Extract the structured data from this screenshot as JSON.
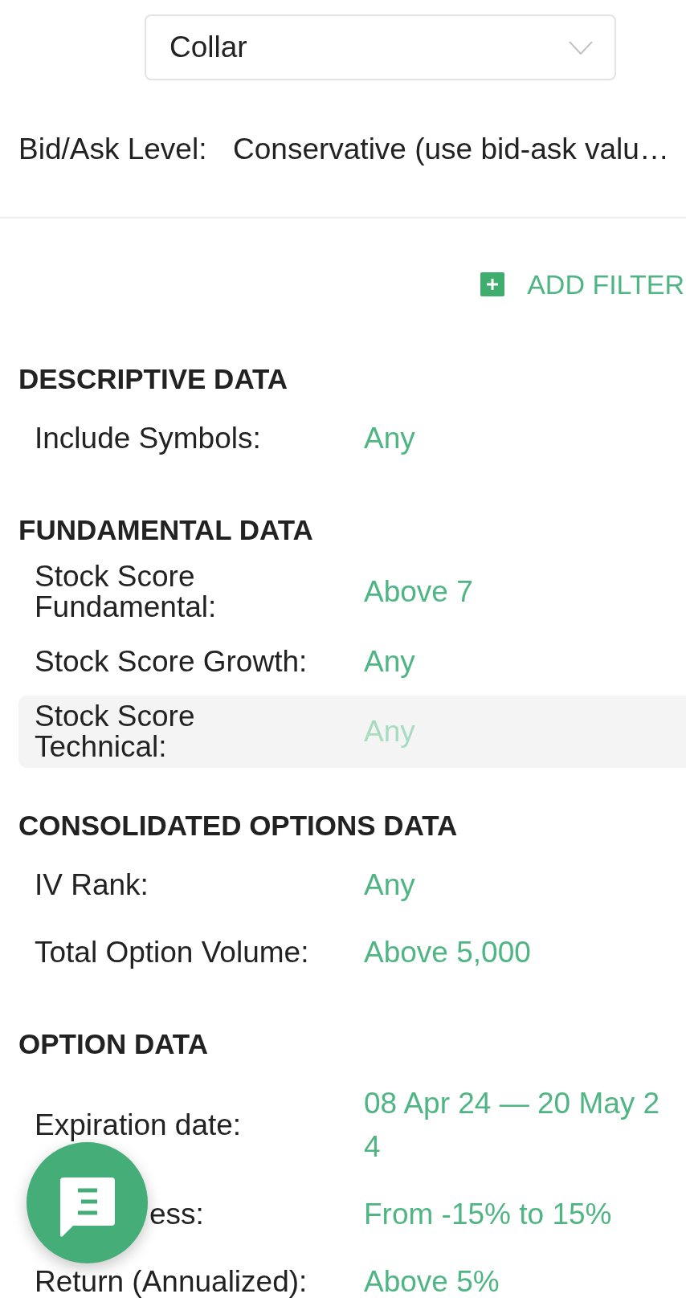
{
  "strategy_select": {
    "value": "Collar"
  },
  "bid_ask": {
    "label": "Bid/Ask Level:",
    "value": "Conservative (use bid-ask valu…"
  },
  "add_filter": {
    "label": "ADD FILTER"
  },
  "sections": [
    {
      "title": "DESCRIPTIVE DATA",
      "filters": [
        {
          "label": "Include Symbols:",
          "value": "Any",
          "highlighted": false,
          "partly_hidden": false
        }
      ]
    },
    {
      "title": "FUNDAMENTAL DATA",
      "filters": [
        {
          "label": "Stock Score Fundamental:",
          "value": "Above 7",
          "highlighted": false,
          "partly_hidden": false
        },
        {
          "label": "Stock Score Growth:",
          "value": "Any",
          "highlighted": false,
          "partly_hidden": false
        },
        {
          "label": "Stock Score Technical:",
          "value": "Any",
          "highlighted": true,
          "partly_hidden": false
        }
      ]
    },
    {
      "title": "CONSOLIDATED OPTIONS DATA",
      "filters": [
        {
          "label": "IV Rank:",
          "value": "Any",
          "highlighted": false,
          "partly_hidden": false
        },
        {
          "label": "Total Option Volume:",
          "value": "Above 5,000",
          "highlighted": false,
          "partly_hidden": false
        }
      ]
    },
    {
      "title": "OPTION DATA",
      "filters": [
        {
          "label": "Expiration date:",
          "value": "08 Apr 24 — 20 May 24",
          "highlighted": false,
          "partly_hidden": false
        },
        {
          "label": "ess:",
          "value": "From -15% to 15%",
          "highlighted": false,
          "partly_hidden": true
        },
        {
          "label": "Return (Annualized):",
          "value": "Above 5%",
          "highlighted": false,
          "partly_hidden": false
        }
      ]
    }
  ]
}
